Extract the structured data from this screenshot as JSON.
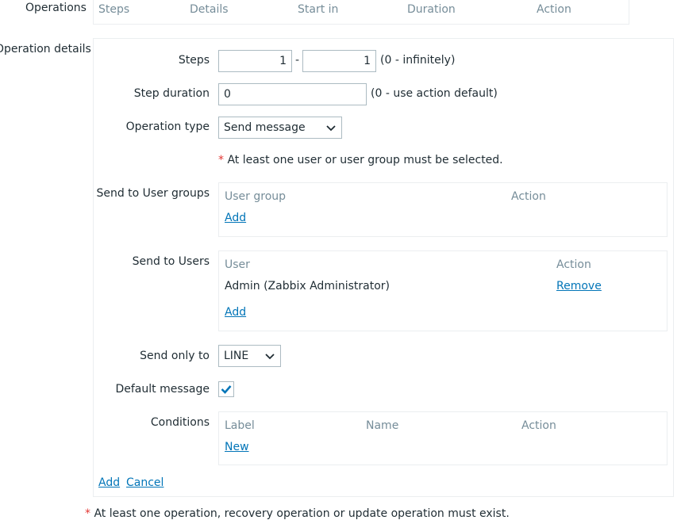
{
  "operations": {
    "label": "Operations",
    "columns": [
      "Steps",
      "Details",
      "Start in",
      "Duration",
      "Action"
    ]
  },
  "operation_details": {
    "label": "Operation details",
    "steps": {
      "label": "Steps",
      "from": "1",
      "to": "1",
      "separator": "-",
      "hint": "(0 - infinitely)"
    },
    "step_duration": {
      "label": "Step duration",
      "value": "0",
      "hint": "(0 - use action default)"
    },
    "operation_type": {
      "label": "Operation type",
      "value": "Send message"
    },
    "required_note": {
      "asterisk": "*",
      "text": "At least one user or user group must be selected."
    },
    "user_groups": {
      "label": "Send to User groups",
      "col_group": "User group",
      "col_action": "Action",
      "add": "Add"
    },
    "users": {
      "label": "Send to Users",
      "col_user": "User",
      "col_action": "Action",
      "rows": [
        {
          "user": "Admin (Zabbix Administrator)",
          "action": "Remove"
        }
      ],
      "add": "Add"
    },
    "send_only_to": {
      "label": "Send only to",
      "value": "LINE"
    },
    "default_message": {
      "label": "Default message",
      "checked": true
    },
    "conditions": {
      "label": "Conditions",
      "col_label": "Label",
      "col_name": "Name",
      "col_action": "Action",
      "new": "New"
    },
    "footer": {
      "add": "Add",
      "cancel": "Cancel"
    }
  },
  "bottom_note": {
    "asterisk": "*",
    "text": "At least one operation, recovery operation or update operation must exist."
  },
  "colors": {
    "link": "#0275b8",
    "required": "#e33734",
    "border": "#acbbc2",
    "check": "#0275b8"
  }
}
